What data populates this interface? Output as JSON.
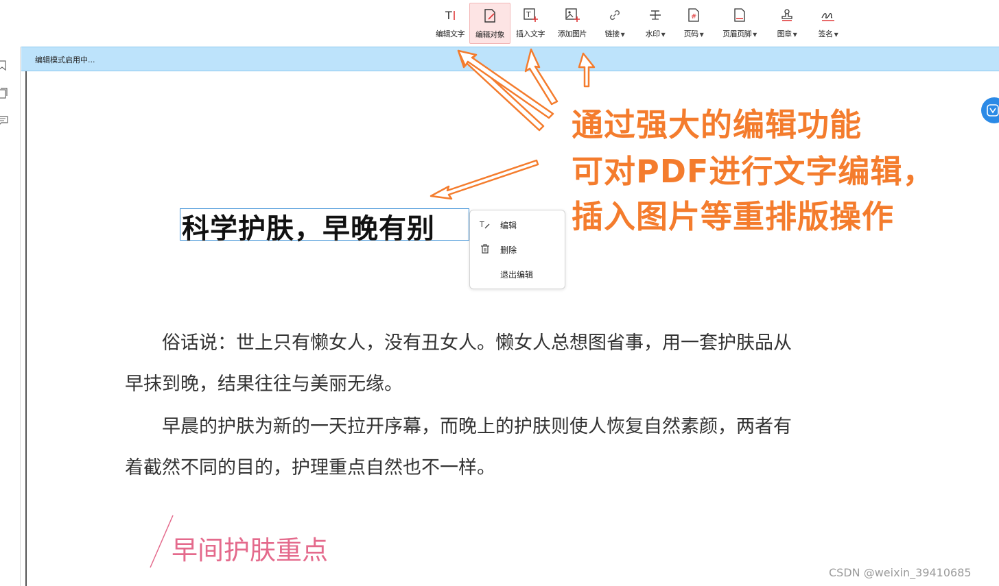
{
  "toolbar": {
    "items": [
      {
        "label": "编辑文字",
        "icon": "edit-text-icon",
        "dropdown": false,
        "active": false
      },
      {
        "label": "编辑对象",
        "icon": "edit-object-icon",
        "dropdown": false,
        "active": true
      },
      {
        "label": "插入文字",
        "icon": "insert-text-icon",
        "dropdown": false,
        "active": false
      },
      {
        "label": "添加图片",
        "icon": "add-image-icon",
        "dropdown": false,
        "active": false
      },
      {
        "label": "链接",
        "icon": "link-icon",
        "dropdown": true,
        "active": false
      },
      {
        "label": "水印",
        "icon": "watermark-icon",
        "dropdown": true,
        "active": false
      },
      {
        "label": "页码",
        "icon": "page-number-icon",
        "dropdown": true,
        "active": false
      },
      {
        "label": "页眉页脚",
        "icon": "header-footer-icon",
        "dropdown": true,
        "active": false
      },
      {
        "label": "图章",
        "icon": "stamp-icon",
        "dropdown": true,
        "active": false
      },
      {
        "label": "签名",
        "icon": "signature-icon",
        "dropdown": true,
        "active": false
      }
    ]
  },
  "edit_bar": {
    "status": "编辑模式启用中..."
  },
  "document": {
    "title": "科学护肤，早晚有别",
    "paragraphs": [
      "　　俗话说：世上只有懒女人，没有丑女人。懒女人总想图省事，用一套护肤品从",
      "早抹到晚，结果往往与美丽无缘。",
      "　　早晨的护肤为新的一天拉开序幕，而晚上的护肤则使人恢复自然素颜，两者有",
      "着截然不同的目的，护理重点自然也不一样。"
    ],
    "section_heading": "早间护肤重点"
  },
  "context_menu": {
    "items": [
      {
        "label": "编辑",
        "icon": "edit-icon"
      },
      {
        "label": "删除",
        "icon": "trash-icon"
      },
      {
        "label": "退出编辑",
        "icon": ""
      }
    ]
  },
  "annotation": {
    "lines": [
      "通过强大的编辑功能",
      "可对PDF进行文字编辑，",
      "插入图片等重排版操作"
    ],
    "color": "#f47c2d"
  },
  "colors": {
    "edit_bar_bg": "#bde3fb",
    "active_tool_bg": "#fde4e4",
    "selection_border": "#3a8fd6",
    "section_heading": "#e46a8c",
    "float_button": "#2b8ae6"
  },
  "watermark": "CSDN @weixin_39410685"
}
